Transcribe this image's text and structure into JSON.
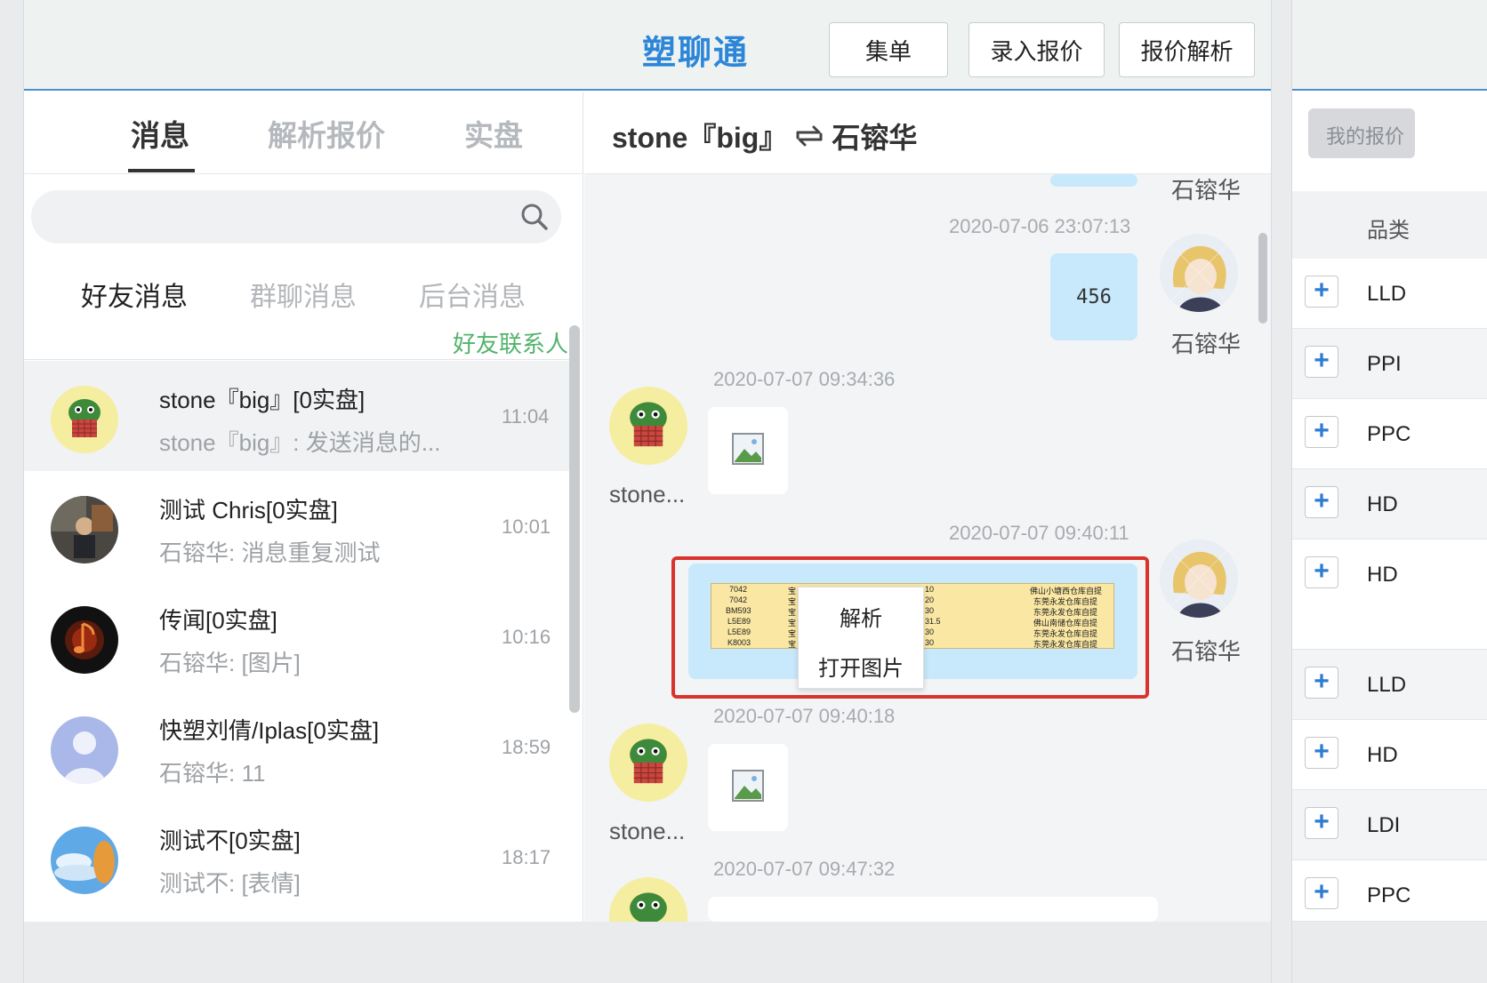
{
  "header": {
    "brand": "塑聊通",
    "buttons": [
      "集单",
      "录入报价",
      "报价解析"
    ]
  },
  "left": {
    "main_tabs": [
      "消息",
      "解析报价",
      "实盘"
    ],
    "active_main_tab": 0,
    "search_placeholder": "",
    "sub_tabs": [
      "好友消息",
      "群聊消息",
      "后台消息"
    ],
    "friends_link": "好友联系人",
    "conversations": [
      {
        "name": "stone『big』[0实盘]",
        "message": "stone『big』: 发送消息的...",
        "time": "11:04",
        "avatar": "frog-avatar"
      },
      {
        "name": "测试 Chris[0实盘]",
        "message": "石镕华: 消息重复测试",
        "time": "10:01",
        "avatar": "photo-avatar"
      },
      {
        "name": "传闻[0实盘]",
        "message": "石镕华: [图片]",
        "time": "10:16",
        "avatar": "music-avatar"
      },
      {
        "name": "快塑刘倩/Iplas[0实盘]",
        "message": "石镕华: 11",
        "time": "18:59",
        "avatar": "default-person-avatar"
      },
      {
        "name": "测试不[0实盘]",
        "message": "测试不: [表情]",
        "time": "18:17",
        "avatar": "sky-avatar"
      }
    ]
  },
  "chat": {
    "title_left": "stone『big』",
    "title_right": "石镕华",
    "me_name": "石镕华",
    "other_name": "stone...",
    "timestamps": [
      "2020-07-06 23:07:13",
      "2020-07-07 09:34:36",
      "2020-07-07 09:40:11",
      "2020-07-07 09:40:18",
      "2020-07-07 09:47:32"
    ],
    "text_message": "456",
    "context_menu": [
      "解析",
      "打开图片"
    ],
    "sheet_rows": [
      {
        "code": "7042",
        "qty": "10",
        "place": "佛山小塘西仓库自提"
      },
      {
        "code": "7042",
        "qty": "20",
        "place": "东莞永发仓库自提"
      },
      {
        "code": "BM593",
        "qty": "30",
        "place": "东莞永发仓库自提"
      },
      {
        "code": "L5E89",
        "qty": "31.5",
        "place": "佛山南储仓库自提"
      },
      {
        "code": "L5E89",
        "qty": "30",
        "place": "东莞永发仓库自提"
      },
      {
        "code": "K8003",
        "qty": "30",
        "place": "东莞永发仓库自提"
      }
    ]
  },
  "right": {
    "my_quote_button": "我的报价",
    "category_header": "品类",
    "products": [
      "LLD",
      "PPI",
      "PPC",
      "HD",
      "HD",
      "LLD",
      "HD",
      "LDI",
      "PPC"
    ]
  },
  "colors": {
    "brand_blue": "#2d86d8",
    "accent_green": "#52b36b",
    "bubble_blue": "#c8e9fb",
    "highlight_red": "#d9332c"
  }
}
